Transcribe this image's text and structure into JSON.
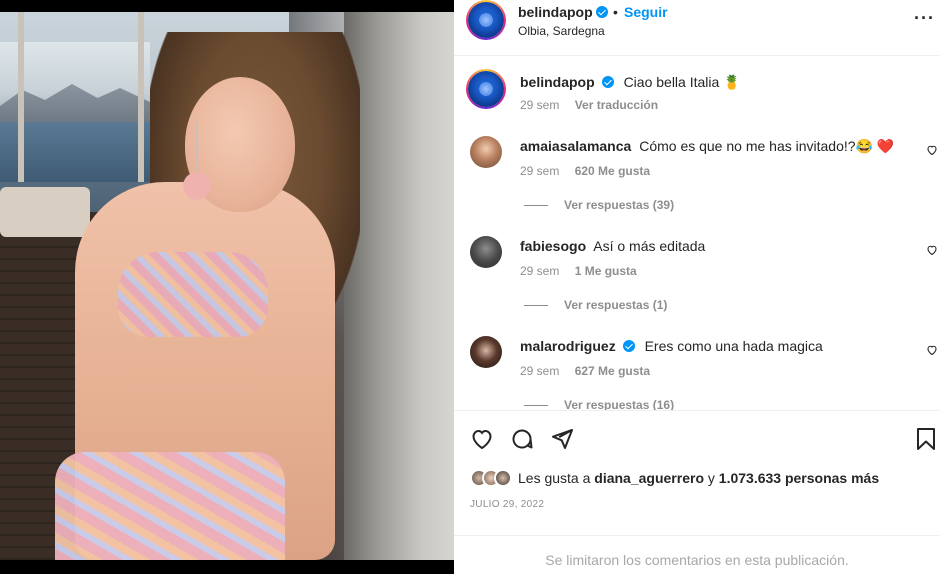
{
  "post": {
    "media_alt": "photo",
    "header": {
      "username": "belindapop",
      "separator": "•",
      "follow_label": "Seguir",
      "location": "Olbia, Sardegna",
      "more_icon": "more-horizontal-icon"
    },
    "caption": {
      "username": "belindapop",
      "text": "Ciao bella Italia 🍍",
      "time": "29 sem",
      "translate_label": "Ver traducción"
    },
    "comments": [
      {
        "username": "amaiasalamanca",
        "verified": false,
        "text": "Cómo es que no me has invitado!?😂 ❤️",
        "time": "29 sem",
        "likes": "620 Me gusta",
        "replies": "Ver respuestas (39)"
      },
      {
        "username": "fabiesogo",
        "verified": false,
        "text": "Así o más editada",
        "time": "29 sem",
        "likes": "1 Me gusta",
        "replies": "Ver respuestas (1)"
      },
      {
        "username": "malarodriguez",
        "verified": true,
        "text": "Eres como una hada magica",
        "time": "29 sem",
        "likes": "627 Me gusta",
        "replies": "Ver respuestas (16)"
      }
    ],
    "actions": {
      "like_icon": "heart-icon",
      "comment_icon": "comment-icon",
      "share_icon": "send-icon",
      "save_icon": "bookmark-icon"
    },
    "likes": {
      "prefix": "Les gusta a",
      "user": "diana_aguerrero",
      "connector": "y",
      "others": "1.073.633 personas más"
    },
    "date": "JULIO 29, 2022",
    "footer": "Se limitaron los comentarios en esta publicación.",
    "colors": {
      "accent": "#0095f6",
      "text": "#262626",
      "muted": "#8e8e8e",
      "like_red": "#ed4956"
    }
  }
}
